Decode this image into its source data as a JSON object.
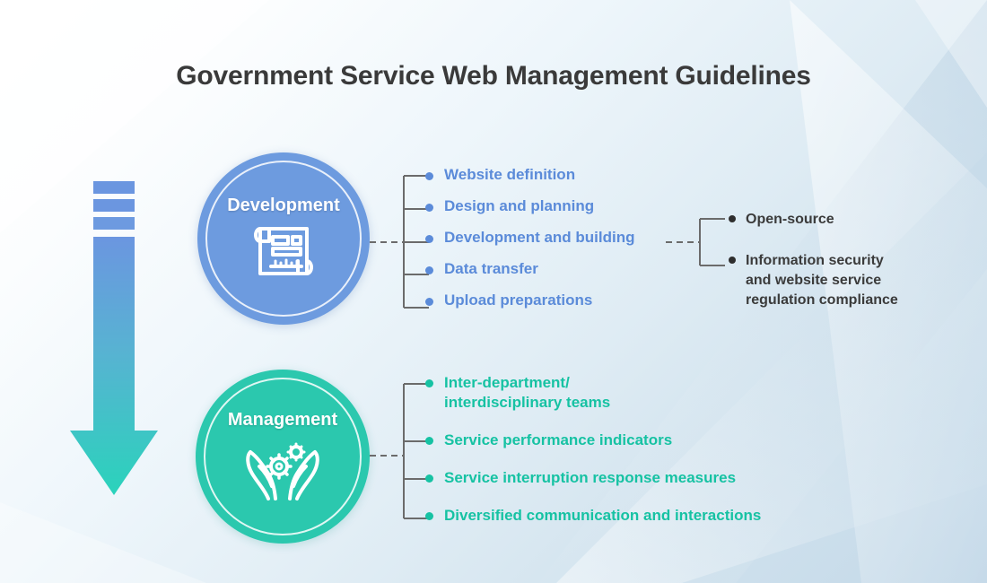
{
  "page": {
    "title": "Government Service Web Management Guidelines"
  },
  "colors": {
    "development_blue": "#5b8bd9",
    "development_circle": "#6d9bdf",
    "management_teal": "#16c2a3",
    "management_circle": "#2bc8ae",
    "sub_item_text": "#3b3b3b",
    "title_text": "#3a3a3a",
    "connector_line": "#6b6b6b",
    "arrow_top": "#6b96e0",
    "arrow_bottom": "#2ad3bb",
    "background_light": "#ffffff",
    "background_dark": "#c3d8e8"
  },
  "flow_arrow": {
    "icon": "down-arrow-icon",
    "direction": "down",
    "dash_segments": 3
  },
  "nodes": [
    {
      "id": "development",
      "label": "Development",
      "icon": "blueprint-icon",
      "color": "#6d9bdf",
      "items": [
        {
          "label": "Website definition"
        },
        {
          "label": "Design and planning"
        },
        {
          "label": "Development and building"
        },
        {
          "label": "Data transfer"
        },
        {
          "label": "Upload preparations"
        }
      ],
      "sub_branch": {
        "parent_item": "Development and building",
        "items": [
          {
            "label": "Open-source"
          },
          {
            "label": "Information security\nand website service\nregulation compliance"
          }
        ]
      }
    },
    {
      "id": "management",
      "label": "Management",
      "icon": "hands-gears-icon",
      "color": "#2bc8ae",
      "items": [
        {
          "label": "Inter-department/\ninterdisciplinary teams"
        },
        {
          "label": "Service performance indicators"
        },
        {
          "label": "Service interruption response measures"
        },
        {
          "label": "Diversified communication and interactions"
        }
      ]
    }
  ]
}
